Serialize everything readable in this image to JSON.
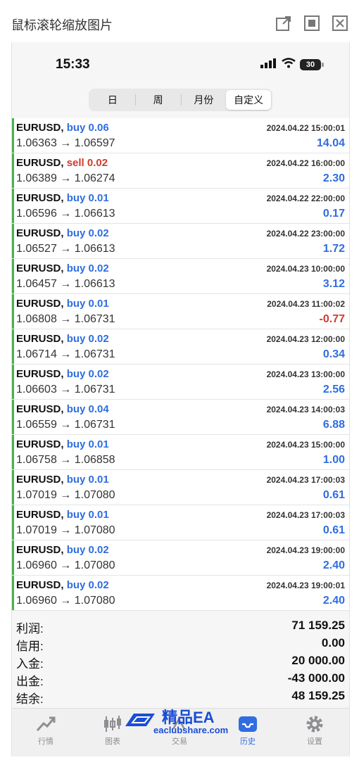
{
  "window": {
    "title": "鼠标滚轮缩放图片",
    "buttons": [
      "popout-icon",
      "restore-icon",
      "close-icon"
    ]
  },
  "status": {
    "time": "15:33",
    "battery": "30"
  },
  "periods": {
    "tabs": [
      "日",
      "周",
      "月份",
      "自定义"
    ],
    "active": "自定义"
  },
  "trades": [
    {
      "symbol": "EURUSD,",
      "side": "buy",
      "volume": "buy 0.06",
      "time": "2024.04.22 15:00:01",
      "prices": "1.06363 → 1.06597",
      "profit": "14.04"
    },
    {
      "symbol": "EURUSD,",
      "side": "sell",
      "volume": "sell 0.02",
      "time": "2024.04.22 16:00:00",
      "prices": "1.06389 → 1.06274",
      "profit": "2.30"
    },
    {
      "symbol": "EURUSD,",
      "side": "buy",
      "volume": "buy 0.01",
      "time": "2024.04.22 22:00:00",
      "prices": "1.06596 → 1.06613",
      "profit": "0.17"
    },
    {
      "symbol": "EURUSD,",
      "side": "buy",
      "volume": "buy 0.02",
      "time": "2024.04.22 23:00:00",
      "prices": "1.06527 → 1.06613",
      "profit": "1.72"
    },
    {
      "symbol": "EURUSD,",
      "side": "buy",
      "volume": "buy 0.02",
      "time": "2024.04.23 10:00:00",
      "prices": "1.06457 → 1.06613",
      "profit": "3.12"
    },
    {
      "symbol": "EURUSD,",
      "side": "buy",
      "volume": "buy 0.01",
      "time": "2024.04.23 11:00:02",
      "prices": "1.06808 → 1.06731",
      "profit": "-0.77"
    },
    {
      "symbol": "EURUSD,",
      "side": "buy",
      "volume": "buy 0.02",
      "time": "2024.04.23 12:00:00",
      "prices": "1.06714 → 1.06731",
      "profit": "0.34"
    },
    {
      "symbol": "EURUSD,",
      "side": "buy",
      "volume": "buy 0.02",
      "time": "2024.04.23 13:00:00",
      "prices": "1.06603 → 1.06731",
      "profit": "2.56"
    },
    {
      "symbol": "EURUSD,",
      "side": "buy",
      "volume": "buy 0.04",
      "time": "2024.04.23 14:00:03",
      "prices": "1.06559 → 1.06731",
      "profit": "6.88"
    },
    {
      "symbol": "EURUSD,",
      "side": "buy",
      "volume": "buy 0.01",
      "time": "2024.04.23 15:00:00",
      "prices": "1.06758 → 1.06858",
      "profit": "1.00"
    },
    {
      "symbol": "EURUSD,",
      "side": "buy",
      "volume": "buy 0.01",
      "time": "2024.04.23 17:00:03",
      "prices": "1.07019 → 1.07080",
      "profit": "0.61"
    },
    {
      "symbol": "EURUSD,",
      "side": "buy",
      "volume": "buy 0.01",
      "time": "2024.04.23 17:00:03",
      "prices": "1.07019 → 1.07080",
      "profit": "0.61"
    },
    {
      "symbol": "EURUSD,",
      "side": "buy",
      "volume": "buy 0.02",
      "time": "2024.04.23 19:00:00",
      "prices": "1.06960 → 1.07080",
      "profit": "2.40"
    },
    {
      "symbol": "EURUSD,",
      "side": "buy",
      "volume": "buy 0.02",
      "time": "2024.04.23 19:00:01",
      "prices": "1.06960 → 1.07080",
      "profit": "2.40"
    }
  ],
  "summary": [
    {
      "label": "利润:",
      "value": "71 159.25"
    },
    {
      "label": "信用:",
      "value": "0.00"
    },
    {
      "label": "入金:",
      "value": "20 000.00"
    },
    {
      "label": "出金:",
      "value": "-43 000.00"
    },
    {
      "label": "结余:",
      "value": "48 159.25"
    }
  ],
  "tabbar": [
    {
      "label": "行情",
      "icon": "quotes-icon"
    },
    {
      "label": "图表",
      "icon": "chart-icon"
    },
    {
      "label": "交易",
      "icon": "trade-icon"
    },
    {
      "label": "历史",
      "icon": "history-icon",
      "active": true
    },
    {
      "label": "设置",
      "icon": "settings-icon"
    }
  ],
  "watermark": {
    "title": "精品EA",
    "url": "eaclubshare.com"
  },
  "colors": {
    "buy": "#2f6de1",
    "sell": "#d23b2a",
    "accent_bar": "#4caf50",
    "active_tab": "#2f6de1"
  }
}
